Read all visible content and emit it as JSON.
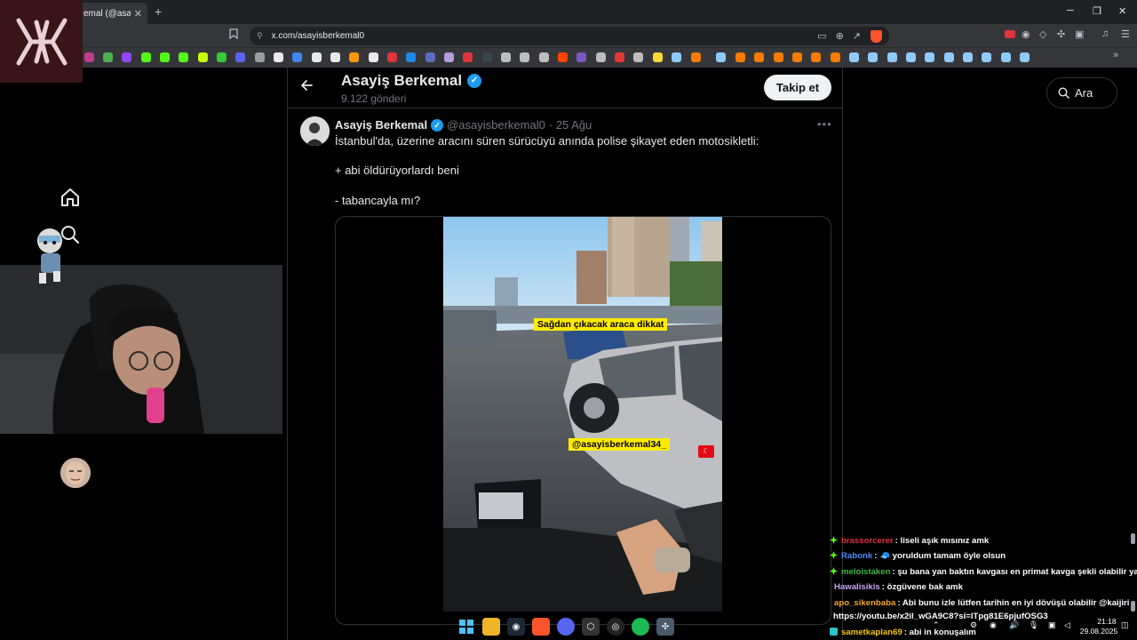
{
  "browser": {
    "tab_title": "emal (@asayi",
    "tab_close": "✕",
    "new_tab": "+",
    "url": "x.com/asayisberkemal0",
    "window_controls": [
      "─",
      "❐",
      "✕"
    ]
  },
  "profile": {
    "name": "Asayiş Berkemal",
    "post_count": "9.122 gönderi",
    "follow_label": "Takip et"
  },
  "search": {
    "label": "Ara"
  },
  "tweet": {
    "author_name": "Asayiş Berkemal",
    "handle": "@asayisberkemal0",
    "date": "· 25 Ağu",
    "lines": [
      "İstanbul'da, üzerine aracını süren sürücüyü anında polise şikayet eden motosikletli:",
      "+ abi öldürüyorlardı beni",
      "- tabancayla mı?"
    ],
    "video_captions": {
      "caption_1": "Sağdan çıkacak araca dikkat",
      "caption_2": "@asayisberkemal34_"
    }
  },
  "chat": [
    {
      "user": "brassorcerer",
      "color": "#e0343c",
      "msg": ": liseli aşık mısınız amk",
      "badge": true
    },
    {
      "user": "Rabonk",
      "color": "#4f8ef7",
      "msg": ": 🧢 yoruldum tamam öyle olsun",
      "badge": true
    },
    {
      "user": "meloistaken",
      "color": "#3fb64a",
      "msg": ": şu bana yan baktın kavgası en primat kavga şekli olabilir ya",
      "badge": true
    },
    {
      "user": "Hawalisikis",
      "color": "#c9a6f5",
      "msg": ": özgüvene bak amk",
      "badge": false
    },
    {
      "user": "apo_sikenbaba",
      "color": "#f5a623",
      "msg": ": Abi bunu izle lütfen tarihin en iyi dövüşü olabilir @kaijiri",
      "badge": false
    },
    {
      "user": "",
      "color": "#ffffff",
      "msg": "https://youtu.be/x2il_wGA9C8?si=lTpg81E6pjufOSG3",
      "badge": false
    },
    {
      "user": "sametkaplan69",
      "color": "#f5c400",
      "msg": ": abi in konuşalım",
      "badge": true
    }
  ],
  "clock": {
    "time": "21:18",
    "date": "29.08.2025"
  },
  "colors": {
    "accent_blue": "#1d9bf0",
    "bg": "#000000",
    "border": "#2f3336",
    "muted": "#71767b"
  }
}
